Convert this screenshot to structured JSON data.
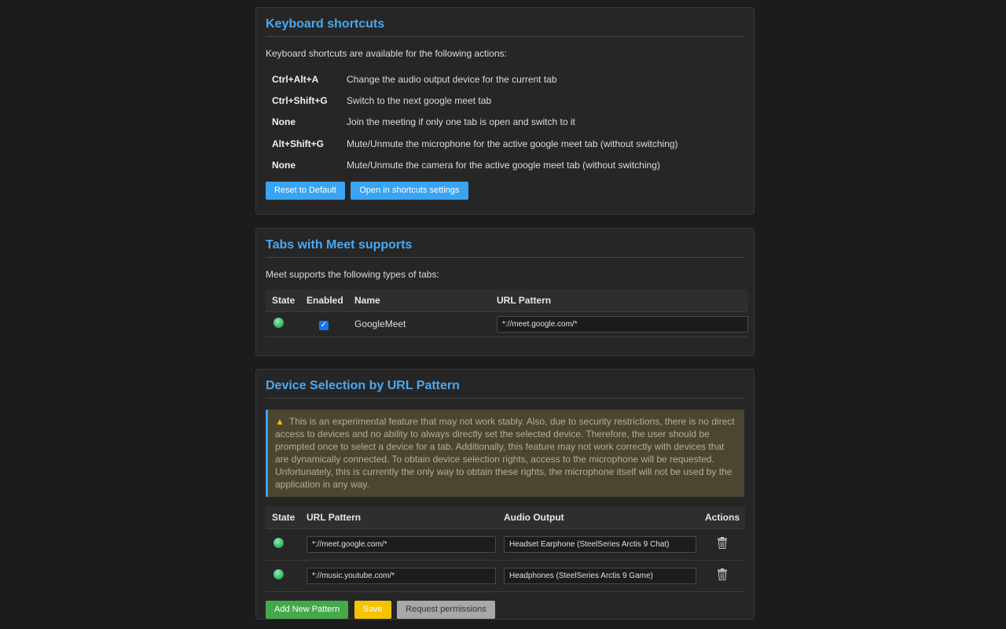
{
  "shortcuts": {
    "title": "Keyboard shortcuts",
    "description": "Keyboard shortcuts are available for the following actions:",
    "items": [
      {
        "key": "Ctrl+Alt+A",
        "action": "Change the audio output device for the current tab"
      },
      {
        "key": "Ctrl+Shift+G",
        "action": "Switch to the next google meet tab"
      },
      {
        "key": "None",
        "action": "Join the meeting if only one tab is open and switch to it"
      },
      {
        "key": "Alt+Shift+G",
        "action": "Mute/Unmute the microphone for the active google meet tab (without switching)"
      },
      {
        "key": "None",
        "action": "Mute/Unmute the camera for the active google meet tab (without switching)"
      }
    ],
    "reset_label": "Reset to Default",
    "open_settings_label": "Open in shortcuts settings"
  },
  "tabs": {
    "title": "Tabs with Meet supports",
    "description": "Meet supports the following types of tabs:",
    "columns": {
      "state": "State",
      "enabled": "Enabled",
      "name": "Name",
      "url": "URL Pattern"
    },
    "rows": [
      {
        "state": "active",
        "enabled": true,
        "name": "GoogleMeet",
        "url": "*://meet.google.com/*"
      }
    ]
  },
  "device": {
    "title": "Device Selection by URL Pattern",
    "warning_icon": "warning-icon",
    "warning": "This is an experimental feature that may not work stably. Also, due to security restrictions, there is no direct access to devices and no ability to always directly set the selected device. Therefore, the user should be prompted once to select a device for a tab. Additionally, this feature may not work correctly with devices that are dynamically connected. To obtain device selection rights, access to the microphone will be requested. Unfortunately, this is currently the only way to obtain these rights, the microphone itself will not be used by the application in any way.",
    "columns": {
      "state": "State",
      "url": "URL Pattern",
      "output": "Audio Output",
      "actions": "Actions"
    },
    "rows": [
      {
        "state": "active",
        "url": "*://meet.google.com/*",
        "output": "Headset Earphone (SteelSeries Arctis 9 Chat)"
      },
      {
        "state": "active",
        "url": "*://music.youtube.com/*",
        "output": "Headphones (SteelSeries Arctis 9 Game)"
      }
    ],
    "add_label": "Add New Pattern",
    "save_label": "Save",
    "request_label": "Request permissions"
  },
  "colors": {
    "accent": "#4aa8f0",
    "active_dot": "#2cab62",
    "warning_bg": "#4a4632",
    "button_blue": "#3aa4f3",
    "button_green": "#45a84a",
    "button_yellow": "#f5c400",
    "button_gray": "#a8a8a8"
  }
}
